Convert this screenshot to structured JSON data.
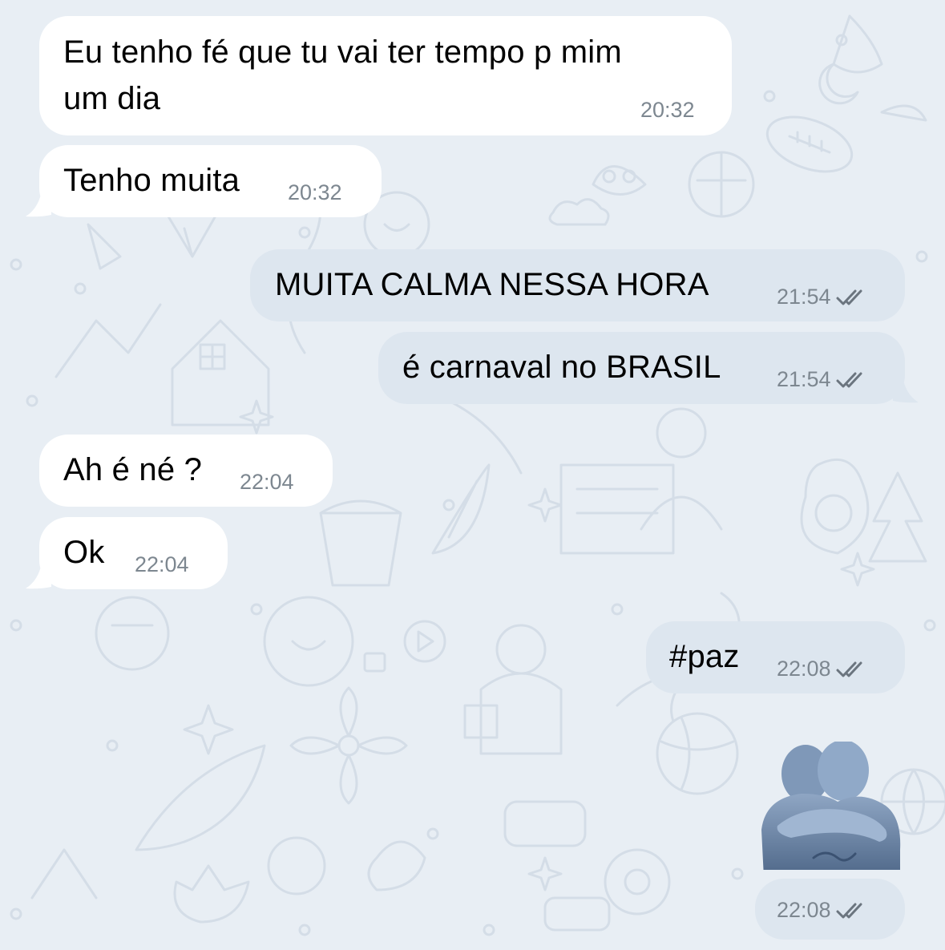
{
  "chat": {
    "messages": [
      {
        "direction": "incoming",
        "lines": [
          "Eu tenho fé que tu vai ter tempo p mim",
          "um dia"
        ],
        "time": "20:32"
      },
      {
        "direction": "incoming",
        "text": "Tenho muita",
        "time": "20:32"
      },
      {
        "direction": "outgoing",
        "text": "MUITA CALMA NESSA HORA",
        "time": "21:54",
        "status": "read"
      },
      {
        "direction": "outgoing",
        "text": "é carnaval no BRASIL",
        "time": "21:54",
        "status": "read"
      },
      {
        "direction": "incoming",
        "text": "Ah é né ?",
        "time": "22:04"
      },
      {
        "direction": "incoming",
        "text": "Ok",
        "time": "22:04"
      },
      {
        "direction": "outgoing",
        "text": "#paz",
        "time": "22:08",
        "status": "read"
      },
      {
        "direction": "outgoing",
        "sticker": "people-hugging-emoji",
        "time": "22:08",
        "status": "read"
      }
    ]
  },
  "colors": {
    "background": "#e8eef4",
    "incoming_bubble": "#ffffff",
    "outgoing_bubble": "#dde6ef",
    "timestamp": "#7d8790",
    "sticker": "#6d86a6"
  },
  "icons": {
    "read_status": "double-check-icon"
  }
}
